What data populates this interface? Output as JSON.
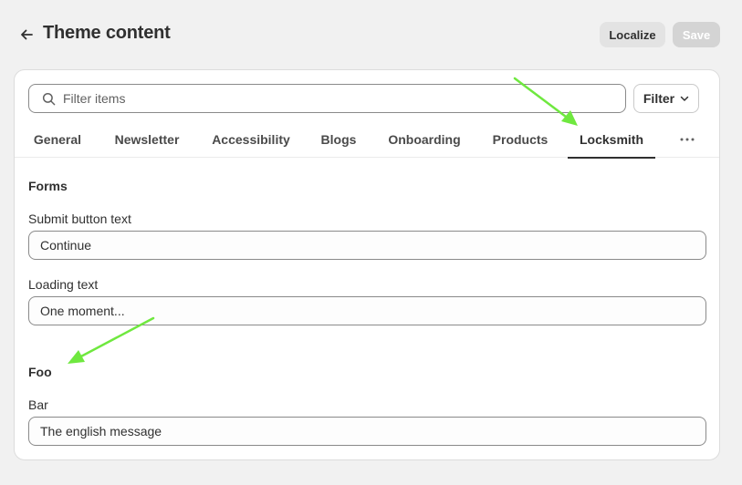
{
  "header": {
    "title": "Theme content",
    "localize_label": "Localize",
    "save_label": "Save"
  },
  "search": {
    "placeholder": "Filter items",
    "value": ""
  },
  "filter": {
    "label": "Filter"
  },
  "tabs": [
    {
      "label": "General",
      "active": false
    },
    {
      "label": "Newsletter",
      "active": false
    },
    {
      "label": "Accessibility",
      "active": false
    },
    {
      "label": "Blogs",
      "active": false
    },
    {
      "label": "Onboarding",
      "active": false
    },
    {
      "label": "Products",
      "active": false
    },
    {
      "label": "Locksmith",
      "active": true
    }
  ],
  "sections": [
    {
      "title": "Forms",
      "fields": [
        {
          "label": "Submit button text",
          "value": "Continue"
        },
        {
          "label": "Loading text",
          "value": "One moment..."
        }
      ]
    },
    {
      "title": "Foo",
      "fields": [
        {
          "label": "Bar",
          "value": "The english message"
        }
      ]
    }
  ],
  "icons": {
    "back": "arrow-left-icon",
    "search": "search-icon",
    "filter": "chevron-down-icon",
    "more": "more-horizontal-icon"
  },
  "colors": {
    "annotation_arrow": "#6fe83f",
    "active_tab_underline": "#303030",
    "background": "#f1f1f1"
  }
}
